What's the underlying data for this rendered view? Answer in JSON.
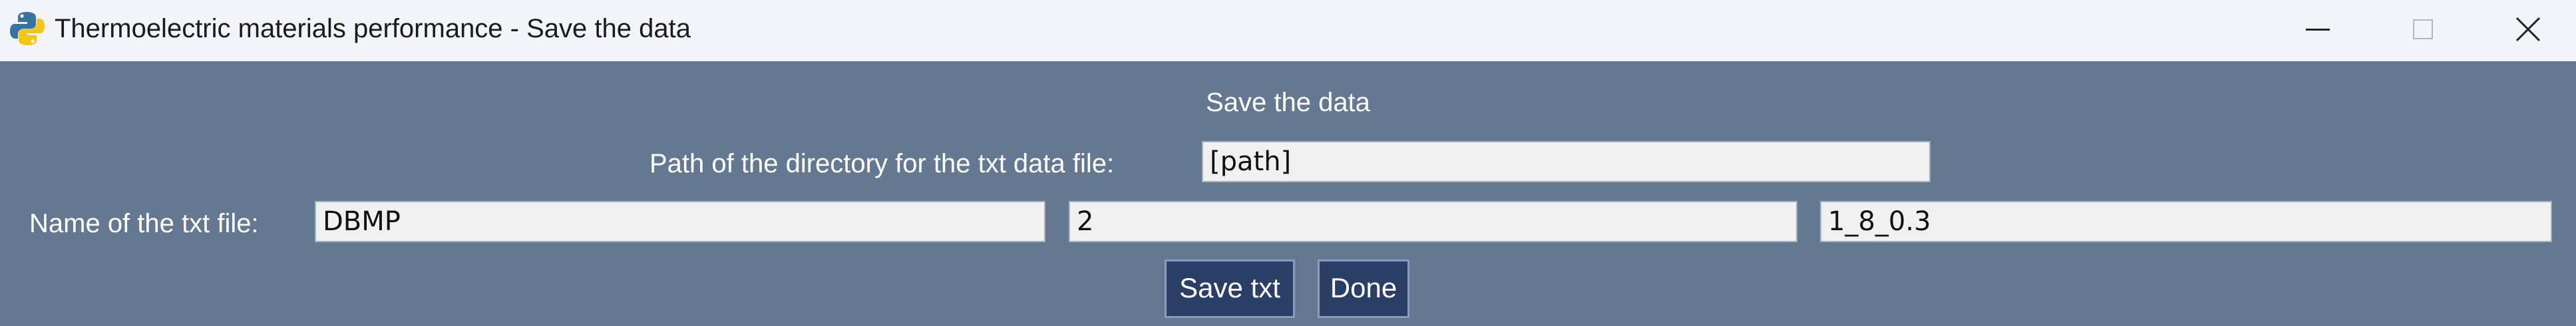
{
  "window": {
    "title": "Thermoelectric materials performance - Save the data",
    "app_icon": "python-icon",
    "controls": {
      "minimize_icon": "minimize-icon",
      "maximize_icon": "maximize-icon",
      "close_icon": "close-icon"
    }
  },
  "form": {
    "heading": "Save the data",
    "path_label": "Path of the directory for the txt data file:",
    "path_value": "[path]",
    "name_label": "Name of the txt file:",
    "name_part1": "DBMP",
    "name_part2": "2",
    "name_part3": "1_8_0.3"
  },
  "buttons": {
    "save_label": "Save txt",
    "done_label": "Done"
  },
  "colors": {
    "background": "#647891",
    "titlebar": "#f3f4f9",
    "button": "#2a3e66",
    "text": "#ffffff"
  }
}
